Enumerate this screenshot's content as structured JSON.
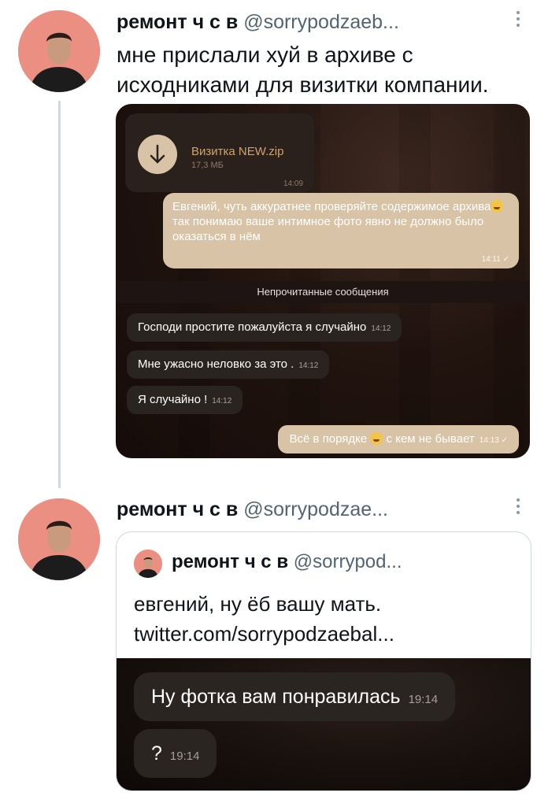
{
  "tweet1": {
    "name": "ремонт ч с в",
    "handle": "@sorrypodzaeb...",
    "text_line1": "мне прислали хуй в архиве с",
    "text_line2": "исходниками для визитки компании."
  },
  "chat": {
    "file_name": "Визитка NEW.zip",
    "file_size": "17,3 МБ",
    "file_time": "14:09",
    "outgoing_message": "Евгений, чуть аккуратнее проверяйте содержимое архива",
    "outgoing_message_rest": "так понимаю ваше интимное фото явно не должно было оказаться в нём",
    "outgoing_time": "14:11",
    "unread_label": "Непрочитанные сообщения",
    "incoming": [
      {
        "text": "Господи простите пожалуйста я случайно",
        "time": "14:12"
      },
      {
        "text": "Мне ужасно неловко за это .",
        "time": "14:12"
      },
      {
        "text": "Я случайно !",
        "time": "14:12"
      }
    ],
    "last_outgoing_a": "Всё в порядке",
    "last_outgoing_b": "с кем не бывает",
    "last_outgoing_time": "14:13"
  },
  "tweet2": {
    "name": "ремонт ч с в",
    "handle": "@sorrypodzae..."
  },
  "quote": {
    "name": "ремонт ч с в",
    "handle": "@sorrypod...",
    "text_line1": "евгений, ну ёб вашу мать.",
    "text_line2": "twitter.com/sorrypodzaebal...",
    "messages": [
      {
        "text": "Ну фотка вам понравилась",
        "time": "19:14"
      },
      {
        "text": "?",
        "time": "19:14"
      }
    ]
  },
  "icons": {
    "avatar": "profile-photo",
    "more": "vertical-dots-icon",
    "download": "download-arrow-icon",
    "emoji": "laughing-emoji-icon"
  }
}
